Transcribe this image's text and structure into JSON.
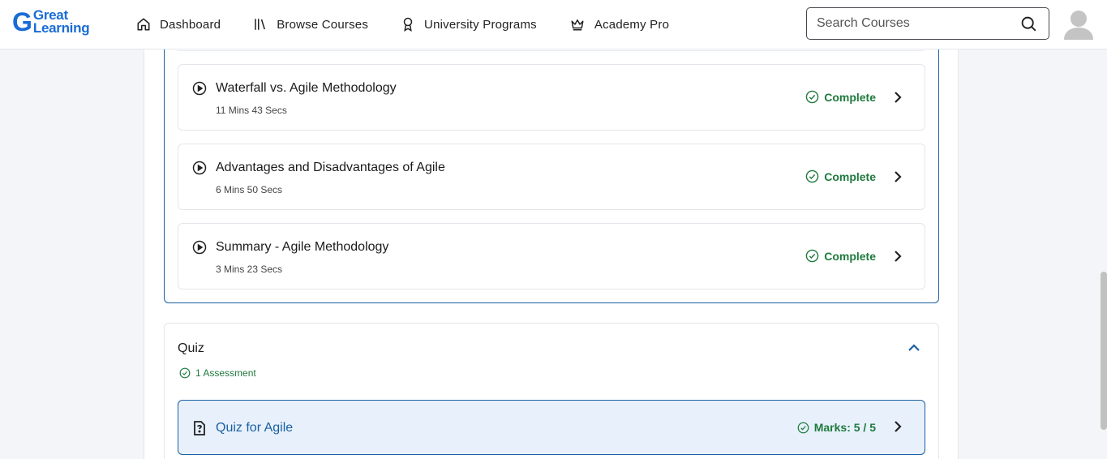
{
  "header": {
    "logo": {
      "line1": "Great",
      "line2": "Learning",
      "mark": "G"
    },
    "nav": [
      {
        "label": "Dashboard",
        "icon": "home-icon"
      },
      {
        "label": "Browse Courses",
        "icon": "library-icon"
      },
      {
        "label": "University Programs",
        "icon": "award-icon"
      },
      {
        "label": "Academy Pro",
        "icon": "crown-icon"
      }
    ],
    "search": {
      "placeholder": "Search Courses"
    }
  },
  "lessons": [
    {
      "title": "Waterfall vs. Agile Methodology",
      "duration": "11 Mins 43 Secs",
      "status": "Complete"
    },
    {
      "title": "Advantages and Disadvantages of Agile",
      "duration": "6 Mins 50 Secs",
      "status": "Complete"
    },
    {
      "title": "Summary - Agile Methodology",
      "duration": "3 Mins 23 Secs",
      "status": "Complete"
    }
  ],
  "quiz": {
    "title": "Quiz",
    "assessment_count": "1 Assessment",
    "items": [
      {
        "title": "Quiz for Agile",
        "marks": "Marks: 5 / 5"
      }
    ]
  },
  "colors": {
    "brand": "#1a6cd6",
    "accent": "#1a5fa3",
    "success": "#1f7a3e",
    "quiz_bg": "#e8f1fb"
  }
}
